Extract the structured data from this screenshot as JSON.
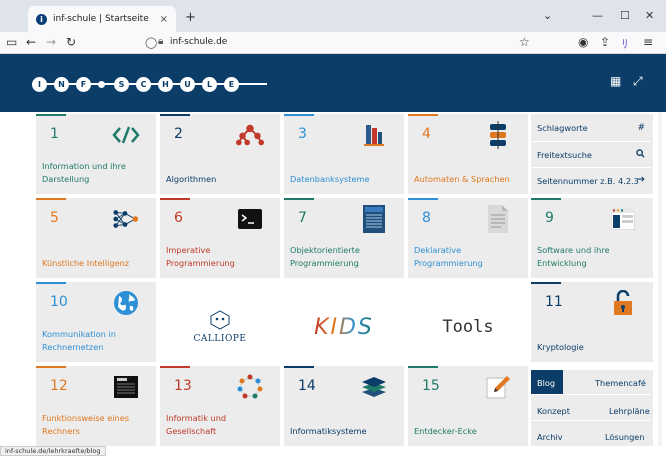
{
  "browser": {
    "tab_title": "inf-schule | Startseite",
    "tab_close": "×",
    "new_tab": "+",
    "url": "inf-schule.de",
    "status_url": "inf-schule.de/lehrkraefte/blog"
  },
  "header": {
    "logo_letters": [
      "I",
      "N",
      "F",
      "S",
      "C",
      "H",
      "U",
      "L",
      "E"
    ]
  },
  "cards": [
    {
      "num": "1",
      "label": "Information und ihre Darstellung",
      "icon": "code-icon"
    },
    {
      "num": "2",
      "label": "Algorithmen",
      "icon": "tree-icon"
    },
    {
      "num": "3",
      "label": "Datenbanksysteme",
      "icon": "books-icon"
    },
    {
      "num": "4",
      "label": "Automaten & Sprachen",
      "icon": "automaton-icon"
    },
    {
      "num": "5",
      "label": "Künstliche Intelligenz",
      "icon": "network-icon"
    },
    {
      "num": "6",
      "label": "Imperative Programmierung",
      "icon": "terminal-icon"
    },
    {
      "num": "7",
      "label": "Objektorientierte Programmierung",
      "icon": "class-diagram-icon"
    },
    {
      "num": "8",
      "label": "Deklarative Programmierung",
      "icon": "document-icon"
    },
    {
      "num": "9",
      "label": "Software und ihre Entwicklung",
      "icon": "window-icon"
    },
    {
      "num": "10",
      "label": "Kommunikation in Rechnernetzen",
      "icon": "globe-icon"
    },
    {
      "num": "11",
      "label": "Kryptologie",
      "icon": "lock-icon"
    },
    {
      "num": "12",
      "label": "Funktionsweise eines Rechners",
      "icon": "chip-icon"
    },
    {
      "num": "13",
      "label": "Informatik und Gesellschaft",
      "icon": "people-circle-icon"
    },
    {
      "num": "14",
      "label": "Informatiksysteme",
      "icon": "layers-icon"
    },
    {
      "num": "15",
      "label": "Entdecker-Ecke",
      "icon": "pencil-icon"
    }
  ],
  "sidebar": {
    "schlagworte": "Schlagworte",
    "schlagworte_icon": "#",
    "freitext": "Freitextsuche",
    "seitennummer": "Seitennummer z.B. 4.2.3",
    "seitennummer_icon": "➔"
  },
  "links": {
    "blog": "Blog",
    "themencafe": "Themencafé",
    "konzept": "Konzept",
    "lehrplaene": "Lehrpläne",
    "archiv": "Archiv",
    "loesungen": "Lösungen"
  },
  "tiles": {
    "calliope": "CALLIOPE",
    "kids": "KIDS",
    "tools": "Tools"
  },
  "colors": {
    "blue": "#0b3d68",
    "orange": "#e0781f",
    "red": "#c0392b",
    "teal": "#1f7a6a",
    "lightblue": "#2d8fd5"
  }
}
